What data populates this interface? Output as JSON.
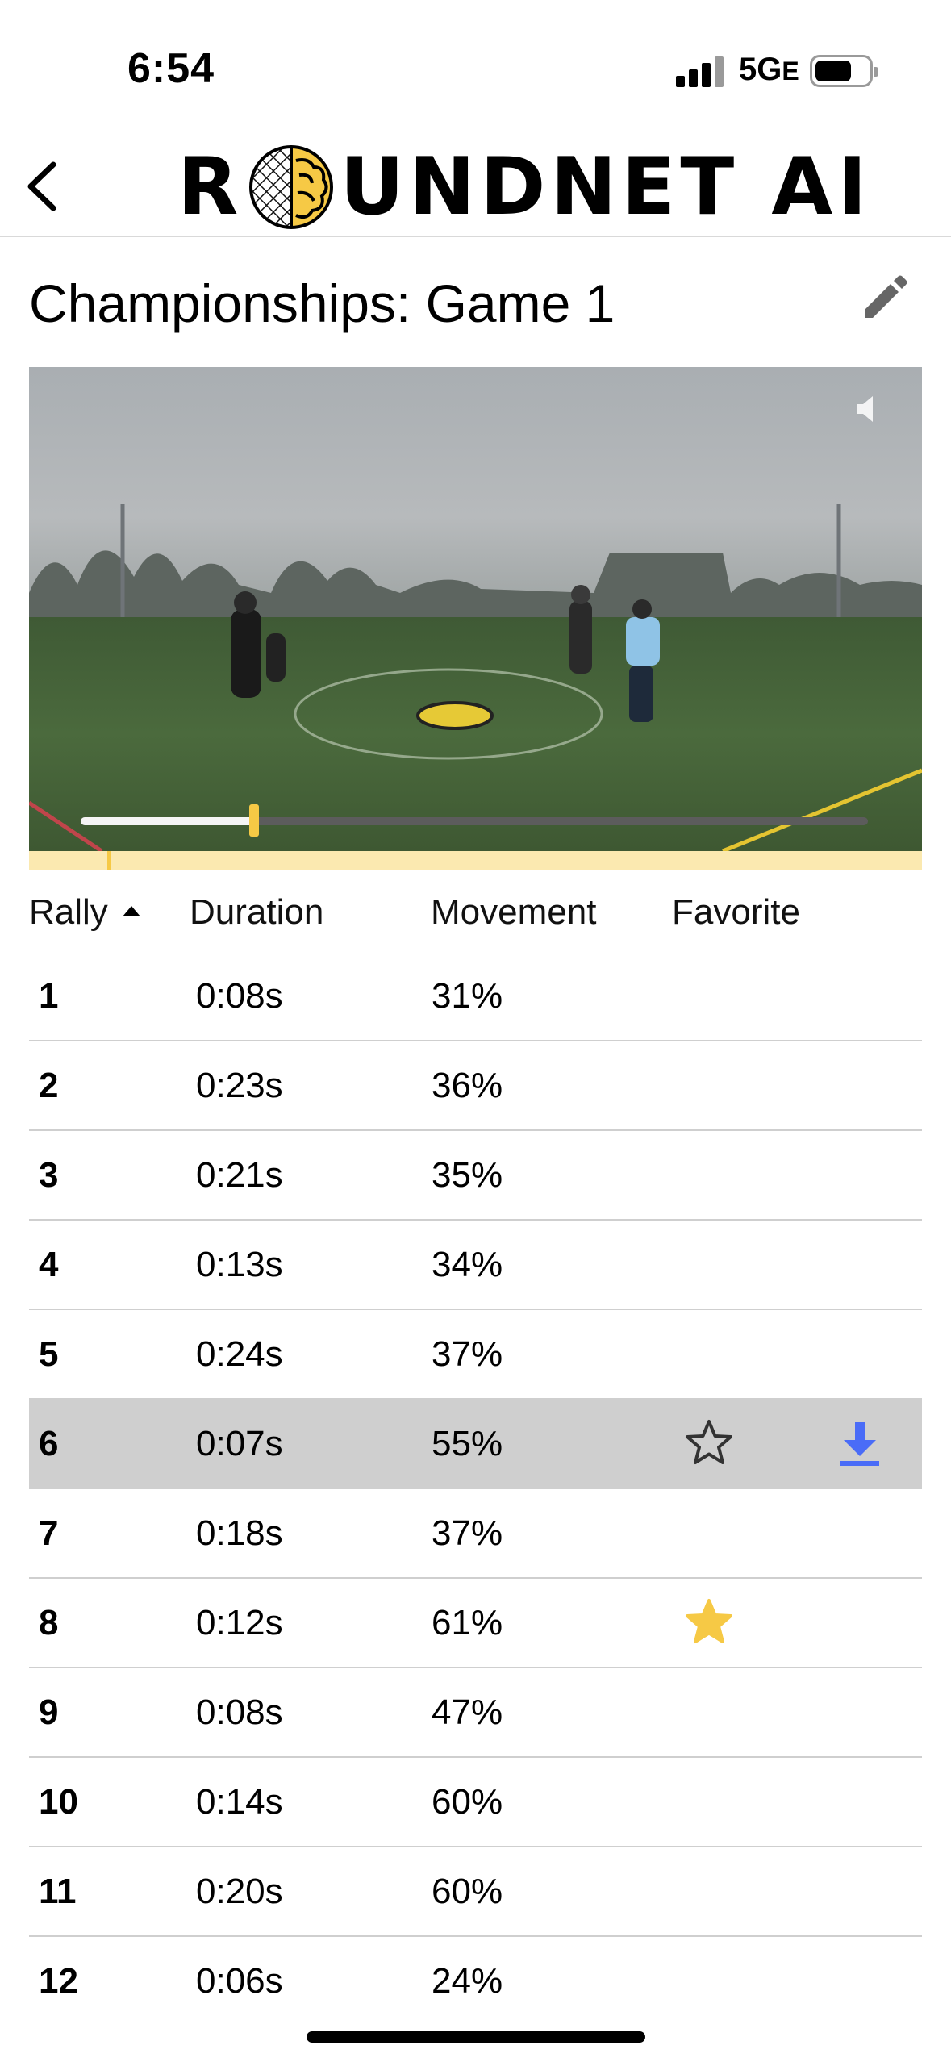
{
  "status_bar": {
    "time": "6:54",
    "network": "5G",
    "network_suffix": "E"
  },
  "header": {
    "logo_left": "R",
    "logo_right": "UNDNET AI"
  },
  "page": {
    "title": "Championships: Game 1"
  },
  "video": {
    "playback_progress": 0.22,
    "muted": true
  },
  "table": {
    "headers": {
      "rally": "Rally",
      "duration": "Duration",
      "movement": "Movement",
      "favorite": "Favorite"
    },
    "rows": [
      {
        "rally": "1",
        "duration": "0:08s",
        "movement": "31%"
      },
      {
        "rally": "2",
        "duration": "0:23s",
        "movement": "36%"
      },
      {
        "rally": "3",
        "duration": "0:21s",
        "movement": "35%"
      },
      {
        "rally": "4",
        "duration": "0:13s",
        "movement": "34%"
      },
      {
        "rally": "5",
        "duration": "0:24s",
        "movement": "37%"
      },
      {
        "rally": "6",
        "duration": "0:07s",
        "movement": "55%",
        "selected": true,
        "favorite": "outline"
      },
      {
        "rally": "7",
        "duration": "0:18s",
        "movement": "37%"
      },
      {
        "rally": "8",
        "duration": "0:12s",
        "movement": "61%",
        "favorite": "filled"
      },
      {
        "rally": "9",
        "duration": "0:08s",
        "movement": "47%"
      },
      {
        "rally": "10",
        "duration": "0:14s",
        "movement": "60%"
      },
      {
        "rally": "11",
        "duration": "0:20s",
        "movement": "60%"
      },
      {
        "rally": "12",
        "duration": "0:06s",
        "movement": "24%"
      }
    ]
  },
  "colors": {
    "accent_yellow": "#F6C945",
    "download_blue": "#4A6CF7",
    "selected_row": "#CFCFCF"
  }
}
